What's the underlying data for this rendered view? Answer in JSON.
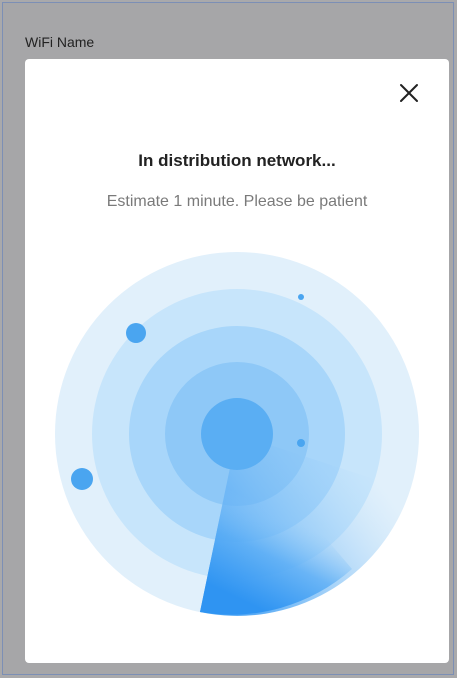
{
  "background": {
    "wifi_label": "WiFi Name"
  },
  "dialog": {
    "title": "In distribution network...",
    "subtitle": "Estimate 1 minute. Please be patient",
    "close_icon": "close-icon",
    "animation_icon": "radar-scan-icon"
  },
  "colors": {
    "overlay": "#a6a6a8",
    "ring1": "#e1f0fb",
    "ring2": "#c7e5fb",
    "ring3": "#a8d6fa",
    "ring4": "#8ec8f7",
    "center": "#5aaef3",
    "dot": "#4aa5f0",
    "sweep": "#3b9cf4"
  }
}
